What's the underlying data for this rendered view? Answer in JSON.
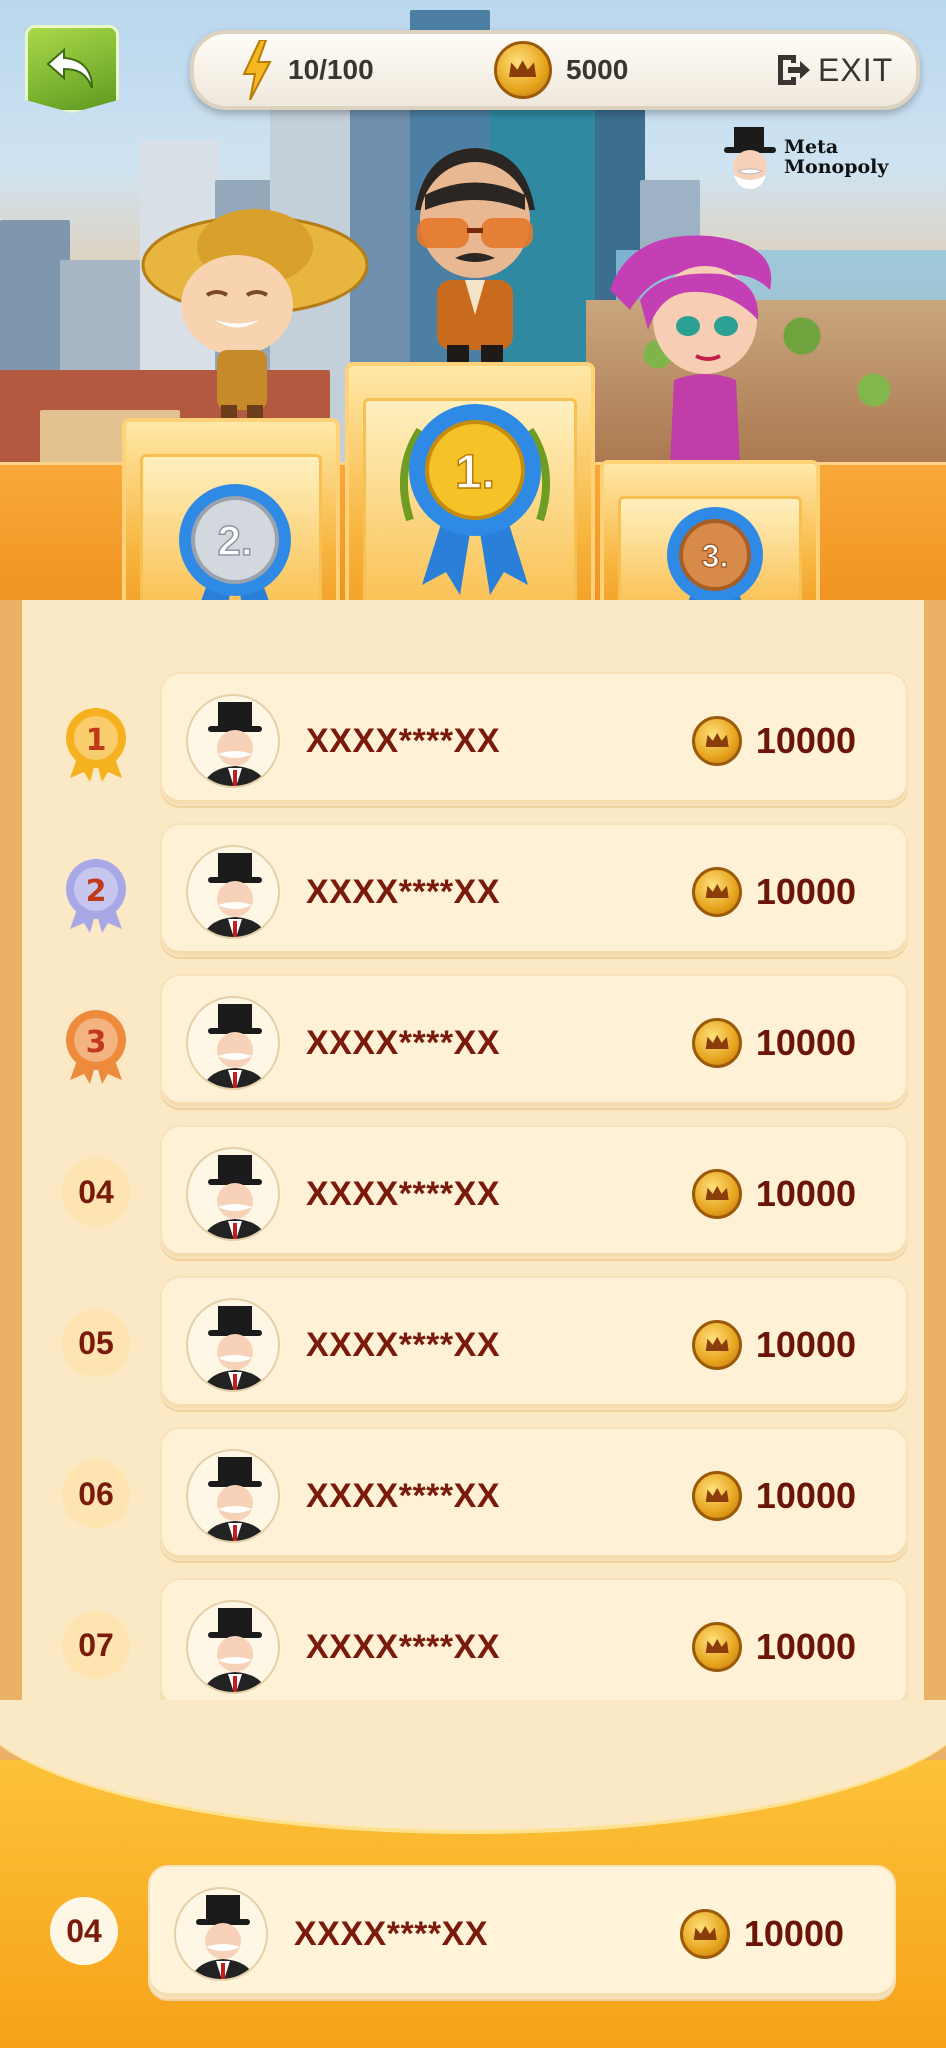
{
  "hud": {
    "energy": "10/100",
    "coins": "5000",
    "exit_label": "EXIT"
  },
  "logo": {
    "line1": "Meta",
    "line2": "Monopoly"
  },
  "podium": {
    "first": "1.",
    "second": "2.",
    "third": "3."
  },
  "leaderboard": [
    {
      "rank": "1",
      "name": "XXXX****XX",
      "score": "10000"
    },
    {
      "rank": "2",
      "name": "XXXX****XX",
      "score": "10000"
    },
    {
      "rank": "3",
      "name": "XXXX****XX",
      "score": "10000"
    },
    {
      "rank": "04",
      "name": "XXXX****XX",
      "score": "10000"
    },
    {
      "rank": "05",
      "name": "XXXX****XX",
      "score": "10000"
    },
    {
      "rank": "06",
      "name": "XXXX****XX",
      "score": "10000"
    },
    {
      "rank": "07",
      "name": "XXXX****XX",
      "score": "10000"
    }
  ],
  "my_entry": {
    "rank": "04",
    "name": "XXXX****XX",
    "score": "10000"
  },
  "colors": {
    "gold_medal": "#f6b21e",
    "silver_medal": "#a9a8e6",
    "bronze_medal": "#ee8a3c",
    "name_text": "#7a1a0b",
    "panel": "#fbe8c4",
    "frame": "#f6a52c"
  }
}
